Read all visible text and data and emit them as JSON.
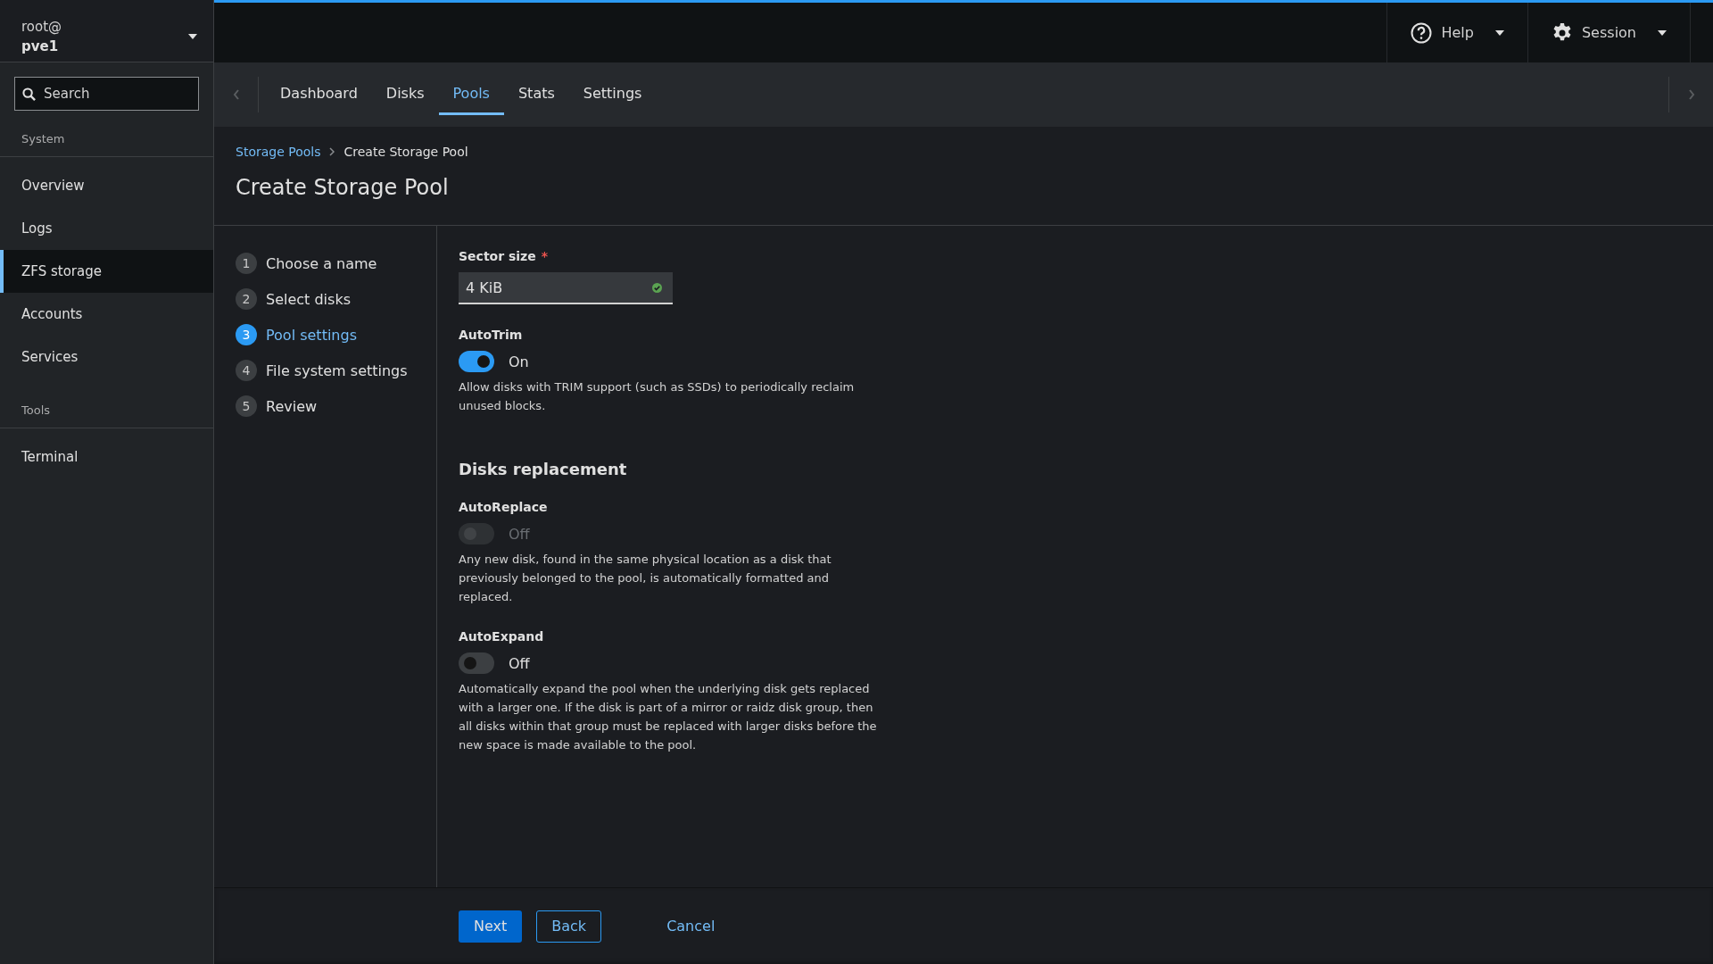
{
  "host": {
    "user": "root@",
    "name": "pve1"
  },
  "search": {
    "placeholder": "Search"
  },
  "sidebar": {
    "sections": [
      {
        "title": "System",
        "items": [
          {
            "label": "Overview",
            "selected": false
          },
          {
            "label": "Logs",
            "selected": false
          },
          {
            "label": "ZFS storage",
            "selected": true
          },
          {
            "label": "Accounts",
            "selected": false
          },
          {
            "label": "Services",
            "selected": false
          }
        ]
      },
      {
        "title": "Tools",
        "items": [
          {
            "label": "Terminal",
            "selected": false
          }
        ]
      }
    ]
  },
  "topbar": {
    "help": "Help",
    "session": "Session"
  },
  "tabs": [
    {
      "label": "Dashboard",
      "selected": false
    },
    {
      "label": "Disks",
      "selected": false
    },
    {
      "label": "Pools",
      "selected": true
    },
    {
      "label": "Stats",
      "selected": false
    },
    {
      "label": "Settings",
      "selected": false
    }
  ],
  "breadcrumb": [
    {
      "label": "Storage Pools",
      "kind": "link"
    },
    {
      "label": "Create Storage Pool",
      "kind": "current"
    }
  ],
  "title": "Create Storage Pool",
  "steps": [
    {
      "number": "1",
      "label": "Choose a name",
      "selected": false
    },
    {
      "number": "2",
      "label": "Select disks",
      "selected": false
    },
    {
      "number": "3",
      "label": "Pool settings",
      "selected": true
    },
    {
      "number": "4",
      "label": "File system settings",
      "selected": false
    },
    {
      "number": "5",
      "label": "Review",
      "selected": false
    }
  ],
  "form": [
    {
      "kind": "select",
      "label": "Sector size",
      "required_mark": "*",
      "value": "4 KiB",
      "valid": true
    },
    {
      "kind": "switch",
      "label": "AutoTrim",
      "on": true,
      "disabled": false,
      "state_text": "On",
      "help": "Allow disks with TRIM support (such as SSDs) to periodically reclaim unused blocks."
    },
    {
      "kind": "heading",
      "label": "Disks replacement"
    },
    {
      "kind": "switch",
      "label": "AutoReplace",
      "on": false,
      "disabled": true,
      "state_text": "Off",
      "help": "Any new disk, found in the same physical location as a disk that previously belonged to the pool, is automatically formatted and replaced."
    },
    {
      "kind": "switch",
      "label": "AutoExpand",
      "on": false,
      "disabled": false,
      "state_text": "Off",
      "help": "Automatically expand the pool when the underlying disk gets replaced with a larger one. If the disk is part of a mirror or raidz disk group, then all disks within that group must be replaced with larger disks before the new space is made available to the pool."
    }
  ],
  "buttons": [
    {
      "label": "Next",
      "kind": "primary"
    },
    {
      "label": "Back",
      "kind": "secondary"
    },
    {
      "label": "Cancel",
      "kind": "link"
    }
  ]
}
